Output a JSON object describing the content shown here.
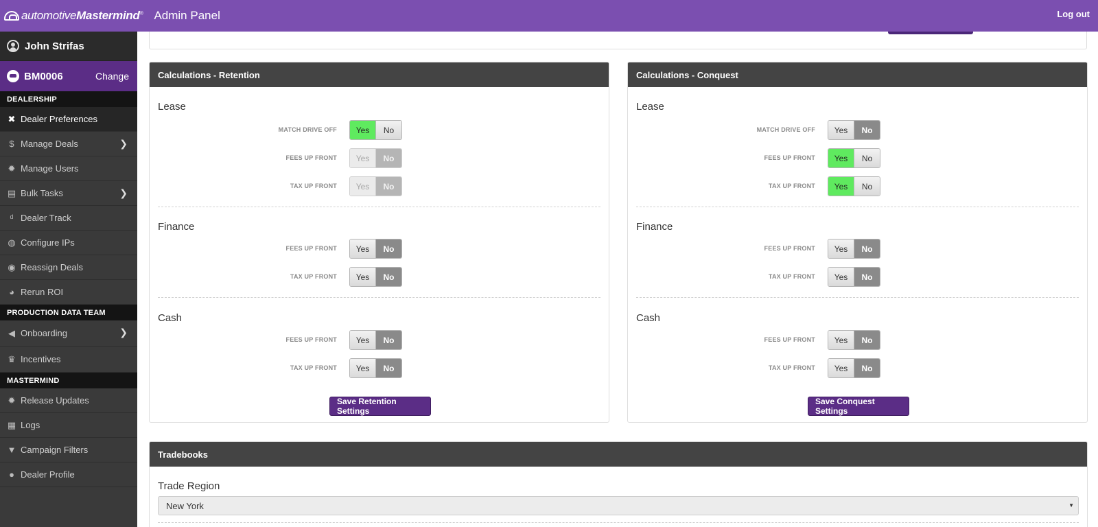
{
  "header": {
    "logo_light": "automotive",
    "logo_bold": "Mastermind",
    "logo_mark": "®",
    "title": "Admin Panel",
    "logout": "Log out"
  },
  "sidebar": {
    "user": "John Strifas",
    "dealer_code": "BM0006",
    "dealer_change": "Change",
    "sections": {
      "dealership": "DEALERSHIP",
      "production": "PRODUCTION DATA TEAM",
      "mastermind": "MASTERMIND"
    },
    "items": [
      {
        "label": "Dealer Preferences",
        "icon": "wrench-icon"
      },
      {
        "label": "Manage Deals",
        "icon": "dollar-tag-icon"
      },
      {
        "label": "Manage Users",
        "icon": "gear-icon"
      },
      {
        "label": "Bulk Tasks",
        "icon": "checklist-icon"
      },
      {
        "label": "Dealer Track",
        "icon": "dealer-track-icon"
      },
      {
        "label": "Configure IPs",
        "icon": "globe-icon"
      },
      {
        "label": "Reassign Deals",
        "icon": "reassign-icon"
      },
      {
        "label": "Rerun ROI",
        "icon": "pie-icon"
      },
      {
        "label": "Onboarding",
        "icon": "megaphone-icon"
      },
      {
        "label": "Incentives",
        "icon": "money-bag-icon"
      },
      {
        "label": "Release Updates",
        "icon": "gear-icon"
      },
      {
        "label": "Logs",
        "icon": "logs-icon"
      },
      {
        "label": "Campaign Filters",
        "icon": "filter-icon"
      },
      {
        "label": "Dealer Profile",
        "icon": "car-icon"
      }
    ]
  },
  "toggle": {
    "yes": "Yes",
    "no": "No"
  },
  "retention": {
    "title": "Calculations - Retention",
    "lease": {
      "title": "Lease",
      "rows": [
        {
          "label": "MATCH DRIVE OFF",
          "value": "Yes",
          "enabled": true
        },
        {
          "label": "FEES UP FRONT",
          "value": "No",
          "enabled": false
        },
        {
          "label": "TAX UP FRONT",
          "value": "No",
          "enabled": false
        }
      ]
    },
    "finance": {
      "title": "Finance",
      "rows": [
        {
          "label": "FEES UP FRONT",
          "value": "No",
          "enabled": true
        },
        {
          "label": "TAX UP FRONT",
          "value": "No",
          "enabled": true
        }
      ]
    },
    "cash": {
      "title": "Cash",
      "rows": [
        {
          "label": "FEES UP FRONT",
          "value": "No",
          "enabled": true
        },
        {
          "label": "TAX UP FRONT",
          "value": "No",
          "enabled": true
        }
      ]
    },
    "save": "Save Retention Settings"
  },
  "conquest": {
    "title": "Calculations - Conquest",
    "lease": {
      "title": "Lease",
      "rows": [
        {
          "label": "MATCH DRIVE OFF",
          "value": "No",
          "enabled": true
        },
        {
          "label": "FEES UP FRONT",
          "value": "Yes",
          "enabled": true
        },
        {
          "label": "TAX UP FRONT",
          "value": "Yes",
          "enabled": true
        }
      ]
    },
    "finance": {
      "title": "Finance",
      "rows": [
        {
          "label": "FEES UP FRONT",
          "value": "No",
          "enabled": true
        },
        {
          "label": "TAX UP FRONT",
          "value": "No",
          "enabled": true
        }
      ]
    },
    "cash": {
      "title": "Cash",
      "rows": [
        {
          "label": "FEES UP FRONT",
          "value": "No",
          "enabled": true
        },
        {
          "label": "TAX UP FRONT",
          "value": "No",
          "enabled": true
        }
      ]
    },
    "save": "Save Conquest Settings"
  },
  "tradebooks": {
    "title": "Tradebooks",
    "region_label": "Trade Region",
    "region_value": "New York"
  },
  "colors": {
    "header": "#7b4fb0",
    "accent": "#5b2d86",
    "toggle_on": "#5fea5f",
    "sidebar": "#3a3a3a"
  }
}
